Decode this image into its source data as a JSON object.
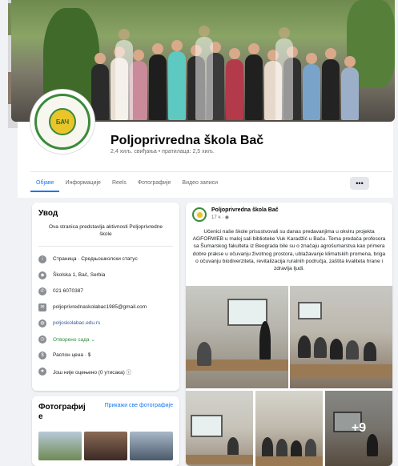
{
  "page": {
    "name": "Poljoprivredna škola Bač",
    "stats": "2,4 хиљ. свиђања • пратилаца: 2,5 хиљ."
  },
  "logo": {
    "text": "БАЧ"
  },
  "tabs": [
    {
      "label": "Објаве",
      "active": true
    },
    {
      "label": "Информације",
      "active": false
    },
    {
      "label": "Reels",
      "active": false
    },
    {
      "label": "Фотографије",
      "active": false
    },
    {
      "label": "Видео записи",
      "active": false
    }
  ],
  "more_label": "•••",
  "intro": {
    "title": "Увод",
    "description": "Ova stranica predstavlja aktivnosti Poljoprivredne škole",
    "items": [
      {
        "icon": "info-icon",
        "text": "Страница · Средњошколски статус"
      },
      {
        "icon": "location-pin-icon",
        "text": "Školska 1, Bač, Serbia"
      },
      {
        "icon": "phone-icon",
        "text": "021 6070387"
      },
      {
        "icon": "email-icon",
        "text": "poljoprivrednaskolabac1985@gmail.com"
      },
      {
        "icon": "globe-icon",
        "text": "poljoskolabac.edu.rs"
      },
      {
        "icon": "clock-icon",
        "text": "Отворено сада ⌄"
      },
      {
        "icon": "price-icon",
        "text": "Распон цена · $"
      },
      {
        "icon": "star-icon",
        "text": "Још није оцењено (0 утисака) ⓘ"
      }
    ]
  },
  "photos": {
    "title": "Фотографиј е",
    "link": "Прикажи све фотографије"
  },
  "post": {
    "author": "Poljoprivredna škola Bač",
    "time": "17 ч · ◉",
    "text": "Učenici naše škole prisustvovali su danas predavanjima u okviru projekta AGFORWEB u maloj sali biblioteke Vuk Karadžić u Baču. Tema predača profesora sa Šumarskog fakulteta iz Beograda bile su o značaju agrošumarstva kao primera dobre prakse u očuvanju životnog prostora, ublažavanje klimatskih promena, briga o očuvanju biodiverziteta, revitalizacija ruralnih područja, zaštita kvaliteta hrane i zdravlja ljudi.",
    "more_photos": "+9"
  },
  "colors": {
    "accent": "#1877f2",
    "background": "#f0f2f5",
    "open": "#2e8b3a"
  }
}
